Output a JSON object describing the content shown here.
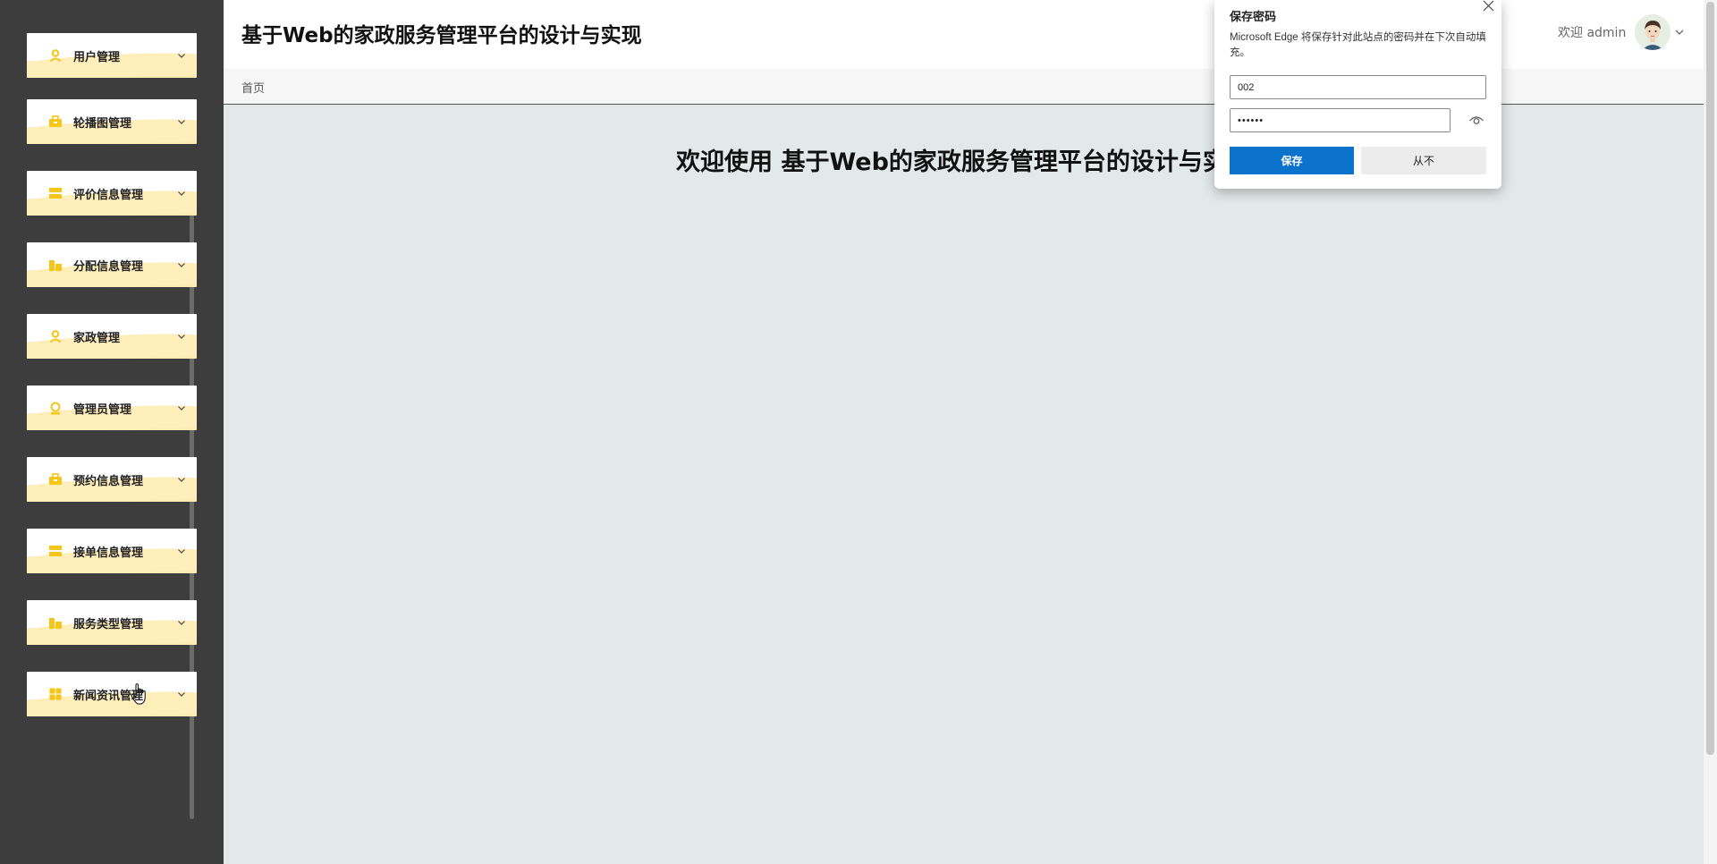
{
  "header": {
    "title": "基于Web的家政服务管理平台的设计与实现",
    "welcome_prefix": "欢迎 admin"
  },
  "breadcrumb": {
    "home": "首页"
  },
  "main": {
    "welcome_text": "欢迎使用 基于Web的家政服务管理平台的设计与实现"
  },
  "sidebar": {
    "items": [
      {
        "label": "用户管理",
        "icon": "user-icon"
      },
      {
        "label": "轮播图管理",
        "icon": "briefcase-icon"
      },
      {
        "label": "评价信息管理",
        "icon": "list-icon"
      },
      {
        "label": "分配信息管理",
        "icon": "buildings-icon"
      },
      {
        "label": "家政管理",
        "icon": "user-icon"
      },
      {
        "label": "管理员管理",
        "icon": "badge-icon"
      },
      {
        "label": "预约信息管理",
        "icon": "briefcase-icon"
      },
      {
        "label": "接单信息管理",
        "icon": "list-icon"
      },
      {
        "label": "服务类型管理",
        "icon": "buildings-icon"
      },
      {
        "label": "新闻资讯管理",
        "icon": "grid-icon"
      }
    ]
  },
  "popup": {
    "title": "保存密码",
    "description": "Microsoft Edge 将保存针对此站点的密码并在下次自动填充。",
    "username_value": "002",
    "password_value": "••••••",
    "save_label": "保存",
    "never_label": "从不"
  },
  "colors": {
    "sidebar_bg": "#3d3d3d",
    "icon_yellow": "#f5c518",
    "menu_wave": "#fdeeba",
    "save_blue": "#0c73cd",
    "content_bg": "#e3e8e8"
  }
}
